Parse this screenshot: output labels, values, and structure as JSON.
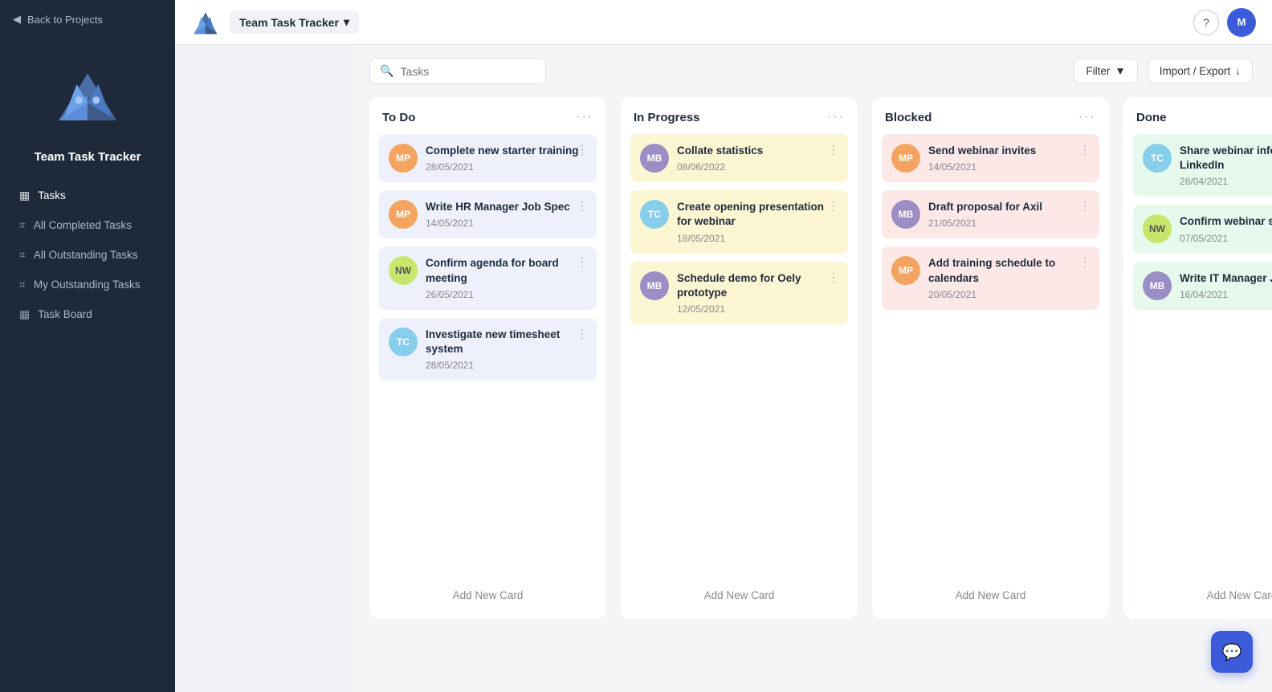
{
  "app": {
    "title": "Team Task Tracker",
    "avatar_initials": "M",
    "search_placeholder": "Tasks",
    "back_label": "Back to Projects",
    "filter_label": "Filter",
    "import_export_label": "Import / Export",
    "chat_icon": "💬"
  },
  "sidebar": {
    "title": "Team Task Tracker",
    "nav_items": [
      {
        "id": "tasks",
        "label": "Tasks",
        "icon": "▦"
      },
      {
        "id": "all-completed",
        "label": "All Completed Tasks",
        "icon": "⌗"
      },
      {
        "id": "all-outstanding",
        "label": "All Outstanding Tasks",
        "icon": "⌗"
      },
      {
        "id": "my-outstanding",
        "label": "My Outstanding Tasks",
        "icon": "⌗"
      },
      {
        "id": "task-board",
        "label": "Task Board",
        "icon": "▦",
        "active": true
      }
    ]
  },
  "columns": [
    {
      "id": "todo",
      "title": "To Do",
      "cards": [
        {
          "id": 1,
          "avatar": "MP",
          "avatar_class": "avatar-mp",
          "title": "Complete new starter training",
          "date": "28/05/2021"
        },
        {
          "id": 2,
          "avatar": "MP",
          "avatar_class": "avatar-mp",
          "title": "Write HR Manager Job Spec",
          "date": "14/05/2021"
        },
        {
          "id": 3,
          "avatar": "NW",
          "avatar_class": "avatar-nw",
          "title": "Confirm agenda for board meeting",
          "date": "26/05/2021"
        },
        {
          "id": 4,
          "avatar": "TC",
          "avatar_class": "avatar-tc",
          "title": "Investigate new timesheet system",
          "date": "28/05/2021"
        }
      ],
      "add_label": "Add New Card",
      "color": "todo"
    },
    {
      "id": "inprogress",
      "title": "In Progress",
      "cards": [
        {
          "id": 5,
          "avatar": "MB",
          "avatar_class": "avatar-mb",
          "title": "Collate statistics",
          "date": "08/06/2022"
        },
        {
          "id": 6,
          "avatar": "TC",
          "avatar_class": "avatar-tc",
          "title": "Create opening presentation for webinar",
          "date": "18/05/2021"
        },
        {
          "id": 7,
          "avatar": "MB",
          "avatar_class": "avatar-mb",
          "title": "Schedule demo for Oely prototype",
          "date": "12/05/2021"
        }
      ],
      "add_label": "Add New Card",
      "color": "inprogress"
    },
    {
      "id": "blocked",
      "title": "Blocked",
      "cards": [
        {
          "id": 8,
          "avatar": "MP",
          "avatar_class": "avatar-mp",
          "title": "Send webinar invites",
          "date": "14/05/2021"
        },
        {
          "id": 9,
          "avatar": "MB",
          "avatar_class": "avatar-mb",
          "title": "Draft proposal for Axil",
          "date": "21/05/2021"
        },
        {
          "id": 10,
          "avatar": "MP",
          "avatar_class": "avatar-mp",
          "title": "Add training schedule to calendars",
          "date": "20/05/2021"
        }
      ],
      "add_label": "Add New Card",
      "color": "blocked"
    },
    {
      "id": "done",
      "title": "Done",
      "cards": [
        {
          "id": 11,
          "avatar": "TC",
          "avatar_class": "avatar-tc",
          "title": "Share webinar information on LinkedIn",
          "date": "28/04/2021"
        },
        {
          "id": 12,
          "avatar": "NW",
          "avatar_class": "avatar-nw",
          "title": "Confirm webinar speakers",
          "date": "07/05/2021"
        },
        {
          "id": 13,
          "avatar": "MB",
          "avatar_class": "avatar-mb",
          "title": "Write IT Manager Job Spec",
          "date": "16/04/2021"
        }
      ],
      "add_label": "Add New Card",
      "color": "done"
    }
  ]
}
